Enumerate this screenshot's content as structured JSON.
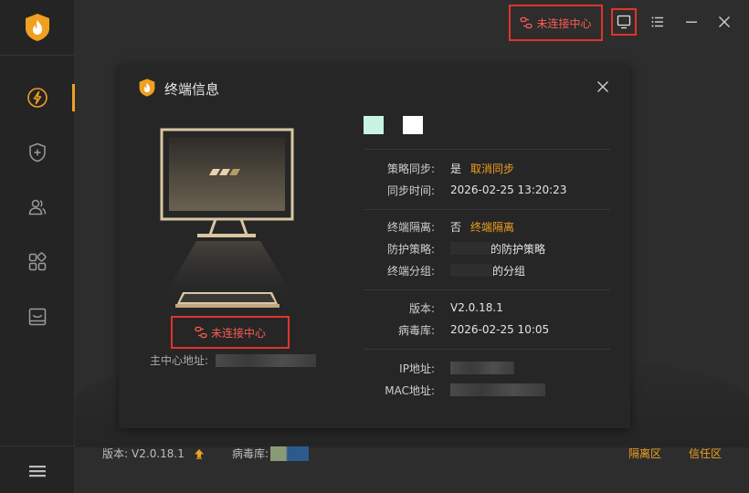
{
  "sidebar": {
    "items": [
      {
        "icon": "lightning-icon",
        "active": true
      },
      {
        "icon": "shield-plus-icon",
        "active": false
      },
      {
        "icon": "users-icon",
        "active": false
      },
      {
        "icon": "apps-icon",
        "active": false
      },
      {
        "icon": "inbox-icon",
        "active": false
      }
    ],
    "menu_icon": "menu-icon"
  },
  "topbar": {
    "status_label": "未连接中心",
    "status_icon": "link-broken-icon",
    "buttons": [
      "monitor-icon",
      "list-icon",
      "minimize-icon",
      "close-icon"
    ]
  },
  "dialog": {
    "title": "终端信息",
    "color_chips": [
      "#c8f5e2",
      "#ffffff"
    ],
    "sync_section": {
      "policy_sync_label": "策略同步:",
      "policy_sync_value": "是",
      "policy_sync_action": "取消同步",
      "sync_time_label": "同步时间:",
      "sync_time_value": "2026-02-25 13:20:23"
    },
    "isolation_section": {
      "isolation_label": "终端隔离:",
      "isolation_value": "否",
      "isolation_action": "终端隔离",
      "protect_label": "防护策略:",
      "protect_value": "的防护策略",
      "group_label": "终端分组:",
      "group_value": "的分组"
    },
    "version_section": {
      "version_label": "版本:",
      "version_value": "V2.0.18.1",
      "virusdb_label": "病毒库:",
      "virusdb_value": "2026-02-25 10:05"
    },
    "network_section": {
      "ip_label": "IP地址:",
      "mac_label": "MAC地址:"
    },
    "left": {
      "status_label": "未连接中心",
      "center_addr_label": "主中心地址:"
    }
  },
  "footer": {
    "version_label": "版本:",
    "version_value": "V2.0.18.1",
    "virusdb_label": "病毒库:",
    "quarantine_label": "隔离区",
    "trust_label": "信任区"
  },
  "colors": {
    "accent": "#f0a020",
    "alert": "#e0352b",
    "background": "#2d2d2d",
    "dialog": "#262626"
  }
}
